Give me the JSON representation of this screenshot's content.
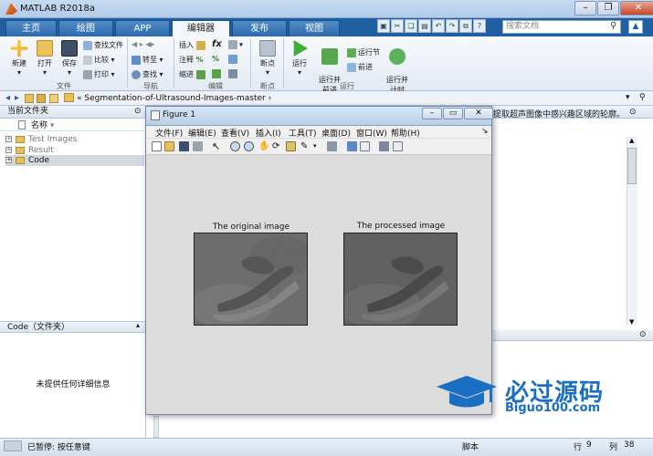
{
  "app": {
    "title": "MATLAB R2018a"
  },
  "tabs": [
    {
      "label": "主页"
    },
    {
      "label": "绘图"
    },
    {
      "label": "APP"
    },
    {
      "label": "编辑器"
    },
    {
      "label": "发布"
    },
    {
      "label": "视图"
    }
  ],
  "active_tab": "编辑器",
  "search": {
    "placeholder": "搜索文档"
  },
  "ribbon": {
    "file": {
      "new": "新建",
      "open": "打开",
      "save": "保存",
      "find_files": "查找文件",
      "compare": "比较",
      "print": "打印",
      "group": "文件"
    },
    "nav": {
      "goto": "转至",
      "find": "查找",
      "group": "导航"
    },
    "edit": {
      "insert": "插入",
      "comment": "注释",
      "indent": "缩进",
      "fx": "fx",
      "group": "编辑"
    },
    "breakpoints": {
      "label": "断点",
      "group": "断点"
    },
    "run": {
      "run": "运行",
      "run_advance": "运行并\n前进",
      "run_section": "运行节",
      "advance": "前进",
      "run_time": "运行并\n计时",
      "group": "运行"
    }
  },
  "address": {
    "path": "« Segmentation-of-Ultrasound-Images-master ›"
  },
  "current_folder": {
    "header": "当前文件夹",
    "column": "名称",
    "items": [
      {
        "name": "Test Images"
      },
      {
        "name": "Result"
      },
      {
        "name": "Code"
      }
    ]
  },
  "details": {
    "header": "Code（文件夹）",
    "empty": "未提供任何详细信息"
  },
  "editor": {
    "visible_text": "提取超声图像中感兴趣区域的轮廓。"
  },
  "figure": {
    "title": "Figure 1",
    "menu": [
      "文件(F)",
      "编辑(E)",
      "查看(V)",
      "插入(I)",
      "工具(T)",
      "桌面(D)",
      "窗口(W)",
      "帮助(H)"
    ],
    "axes": [
      {
        "title": "The original image"
      },
      {
        "title": "The processed image"
      }
    ]
  },
  "status": {
    "left": "已暂停: 按任意键",
    "mode": "脚本",
    "row_label": "行",
    "row": "9",
    "col_label": "列",
    "col": "38"
  },
  "watermark": {
    "text": "必过源码",
    "sub": "Biguo100.com"
  },
  "colors": {
    "tab_bar": "#1f5fa2",
    "watermark": "#1b6fc2"
  }
}
